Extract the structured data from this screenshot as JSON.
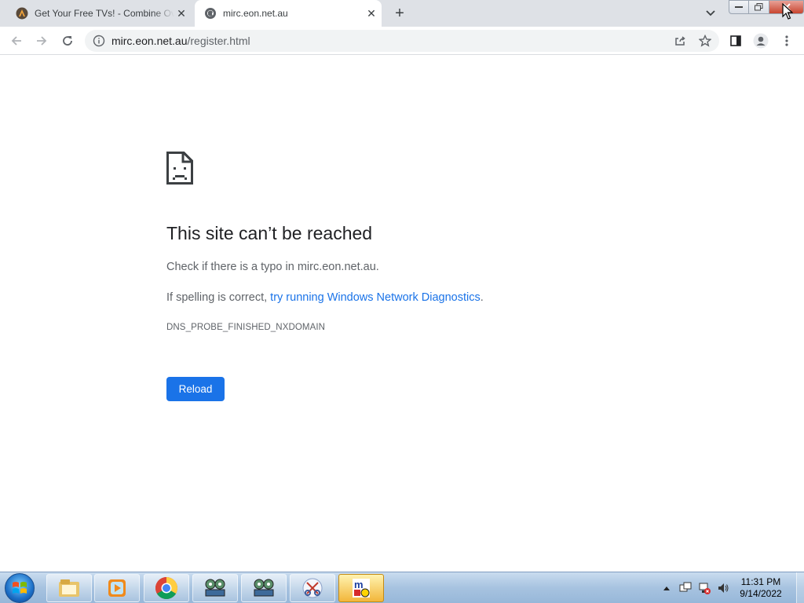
{
  "browser": {
    "tabs": [
      {
        "title": "Get Your Free TVs! - Combine Ov",
        "active": false
      },
      {
        "title": "mirc.eon.net.au",
        "active": true
      }
    ],
    "new_tab_label": "+",
    "address_bar": {
      "host": "mirc.eon.net.au",
      "path": "/register.html"
    }
  },
  "error_page": {
    "title": "This site can’t be reached",
    "line1": "Check if there is a typo in mirc.eon.net.au.",
    "line2_prefix": "If spelling is correct, ",
    "line2_link": "try running Windows Network Diagnostics",
    "line2_suffix": ".",
    "error_code": "DNS_PROBE_FINISHED_NXDOMAIN",
    "reload_label": "Reload"
  },
  "taskbar": {
    "items": [
      "file-explorer-icon",
      "media-player-icon",
      "chrome-icon",
      "netmeeting-icon",
      "netmeeting-icon",
      "scissors-tool-icon",
      "mirc-icon"
    ],
    "clock_time": "11:31 PM",
    "clock_date": "9/14/2022"
  },
  "colors": {
    "accent": "#1a73e8",
    "tabstrip": "#dee1e6",
    "text_secondary": "#5f6368"
  }
}
